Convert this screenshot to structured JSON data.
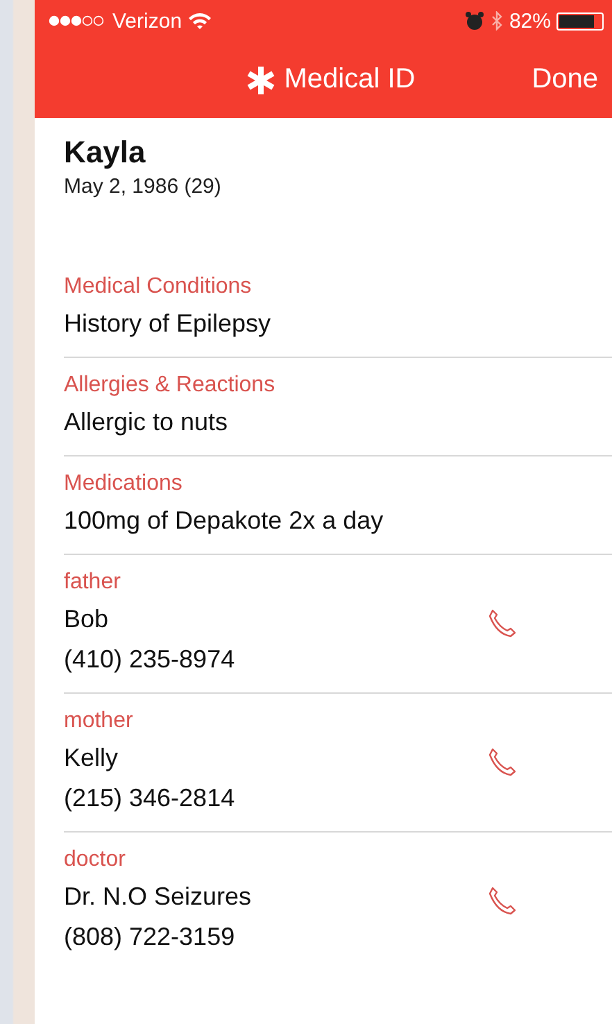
{
  "status_bar": {
    "carrier": "Verizon",
    "battery": "82%"
  },
  "nav": {
    "title": "Medical ID",
    "done": "Done"
  },
  "person": {
    "name": "Kayla",
    "birthdate": "May 2, 1986 (29)"
  },
  "sections": [
    {
      "label": "Medical Conditions",
      "value": "History of Epilepsy"
    },
    {
      "label": "Allergies & Reactions",
      "value": "Allergic to nuts"
    },
    {
      "label": "Medications",
      "value": "100mg of Depakote 2x a day"
    }
  ],
  "contacts": [
    {
      "relation": "father",
      "name": "Bob",
      "phone": "(410) 235-8974"
    },
    {
      "relation": "mother",
      "name": "Kelly",
      "phone": "(215) 346-2814"
    },
    {
      "relation": "doctor",
      "name": "Dr. N.O Seizures",
      "phone": "(808) 722-3159"
    }
  ]
}
